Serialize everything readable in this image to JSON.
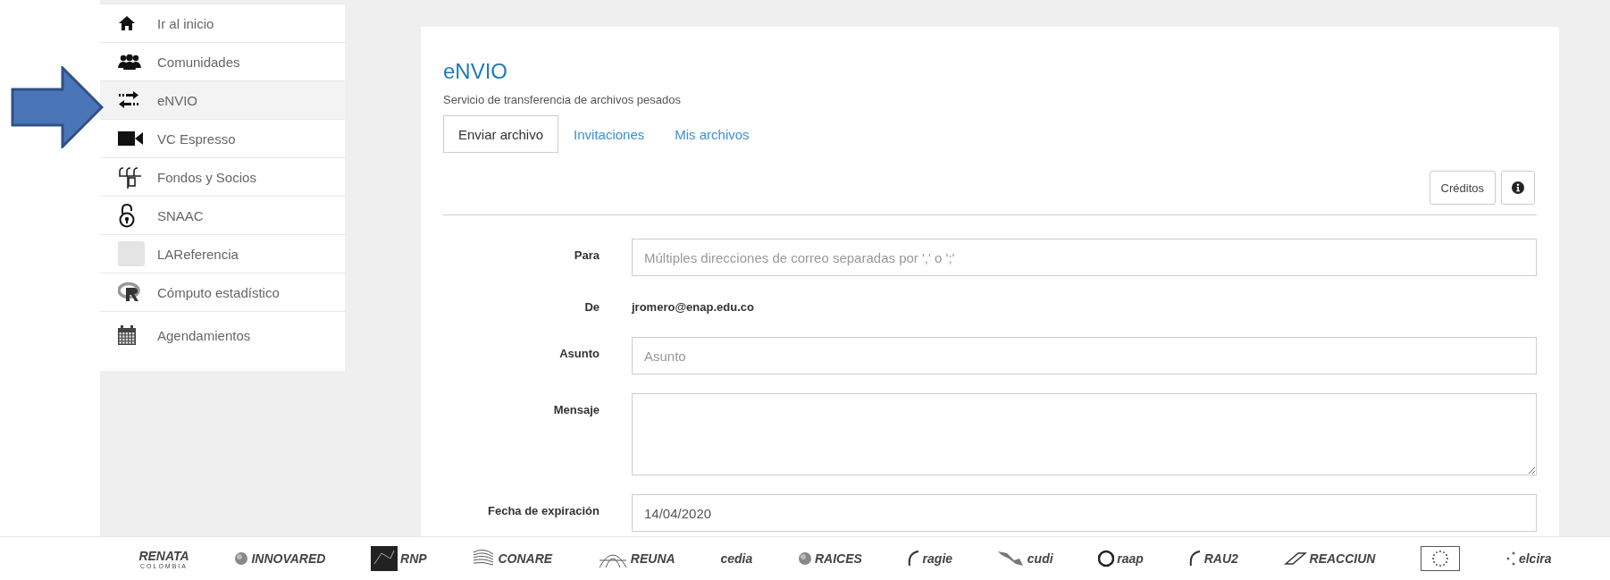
{
  "sidebar": {
    "items": [
      {
        "label": "Ir al inicio",
        "selected": false
      },
      {
        "label": "Comunidades",
        "selected": false
      },
      {
        "label": "eNVIO",
        "selected": true
      },
      {
        "label": "VC Espresso",
        "selected": false
      },
      {
        "label": "Fondos y Socios",
        "selected": false
      },
      {
        "label": "SNAAC",
        "selected": false
      },
      {
        "label": "LAReferencia",
        "selected": false
      },
      {
        "label": "Cómputo estadístico",
        "selected": false
      },
      {
        "label": "Agendamientos",
        "selected": false
      }
    ]
  },
  "page": {
    "title": "eNVIO",
    "subtitle": "Servicio de transferencia de archivos pesados"
  },
  "tabs": [
    {
      "label": "Enviar archivo",
      "selected": true
    },
    {
      "label": "Invitaciones",
      "selected": false
    },
    {
      "label": "Mis archivos",
      "selected": false
    }
  ],
  "toolbar_buttons": [
    "Créditos"
  ],
  "form": {
    "fields": [
      {
        "label": "Para",
        "kind": "input",
        "placeholder": "Múltiples direcciones de correo separadas por ',' o ';'"
      },
      {
        "label": "De",
        "kind": "text",
        "value": "jromero@enap.edu.co"
      },
      {
        "label": "Asunto",
        "kind": "input",
        "placeholder": "Asunto"
      },
      {
        "label": "Mensaje",
        "kind": "textarea"
      },
      {
        "label": "Fecha de expiración",
        "kind": "input",
        "value": "14/04/2020"
      }
    ]
  },
  "footer": {
    "logos": [
      {
        "kind": "plain",
        "text": "RENATA",
        "sub": "COLOMBIA"
      },
      {
        "kind": "globe",
        "text": "INNOVARED"
      },
      {
        "kind": "square",
        "text": "RNP"
      },
      {
        "kind": "sphere",
        "text": "CONARE"
      },
      {
        "kind": "arcs",
        "text": "REUNA"
      },
      {
        "kind": "plain",
        "text": "cedia"
      },
      {
        "kind": "globe",
        "text": "RAICES"
      },
      {
        "kind": "oval",
        "text": "ragie"
      },
      {
        "kind": "map",
        "text": "cudi"
      },
      {
        "kind": "ring",
        "text": "raap"
      },
      {
        "kind": "oval",
        "text": "RAU2"
      },
      {
        "kind": "swoosh",
        "text": "REACCIUN"
      },
      {
        "kind": "flag"
      },
      {
        "kind": "dots",
        "text": "elcira"
      }
    ]
  }
}
